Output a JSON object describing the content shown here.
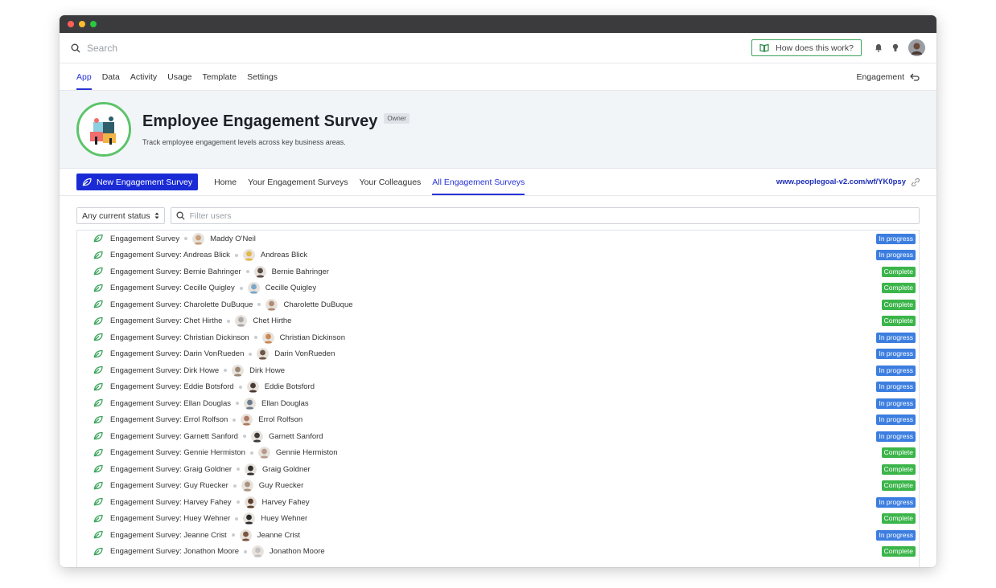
{
  "colors": {
    "accent": "#2634d6",
    "primary_button": "#1a2bd6",
    "in_progress": "#3c7ee0",
    "complete": "#3bb54a",
    "leaf": "#3aa45a"
  },
  "search": {
    "placeholder": "Search"
  },
  "help_button": {
    "label": "How does this work?"
  },
  "nav": {
    "tabs": [
      {
        "label": "App",
        "active": true
      },
      {
        "label": "Data"
      },
      {
        "label": "Activity"
      },
      {
        "label": "Usage"
      },
      {
        "label": "Template"
      },
      {
        "label": "Settings"
      }
    ],
    "right_label": "Engagement"
  },
  "hero": {
    "title": "Employee Engagement Survey",
    "badge": "Owner",
    "subtitle": "Track employee engagement levels across key business areas."
  },
  "actions": {
    "new_button": "New Engagement Survey",
    "tabs": [
      {
        "label": "Home"
      },
      {
        "label": "Your Engagement Surveys"
      },
      {
        "label": "Your Colleagues"
      },
      {
        "label": "All Engagement Surveys",
        "active": true
      }
    ],
    "url": "www.peoplegoal-v2.com/wf/YK0psy"
  },
  "filters": {
    "status_label": "Any current status",
    "filter_placeholder": "Filter users"
  },
  "status_labels": {
    "in_progress": "In progress",
    "complete": "Complete"
  },
  "rows": [
    {
      "title": "Engagement Survey",
      "user": "Maddy O'Neil",
      "status": "in_progress",
      "avatar": "#c9a07c"
    },
    {
      "title": "Engagement Survey: Andreas Blick",
      "user": "Andreas Blick",
      "status": "in_progress",
      "avatar": "#e2b84a"
    },
    {
      "title": "Engagement Survey: Bernie Bahringer",
      "user": "Bernie Bahringer",
      "status": "complete",
      "avatar": "#5a4a44"
    },
    {
      "title": "Engagement Survey: Cecille Quigley",
      "user": "Cecille Quigley",
      "status": "complete",
      "avatar": "#7aa8c9"
    },
    {
      "title": "Engagement Survey: Charolette DuBuque",
      "user": "Charolette DuBuque",
      "status": "complete",
      "avatar": "#b08c74"
    },
    {
      "title": "Engagement Survey: Chet Hirthe",
      "user": "Chet Hirthe",
      "status": "complete",
      "avatar": "#a9a9a9"
    },
    {
      "title": "Engagement Survey: Christian Dickinson",
      "user": "Christian Dickinson",
      "status": "in_progress",
      "avatar": "#c98a55"
    },
    {
      "title": "Engagement Survey: Darin VonRueden",
      "user": "Darin VonRueden",
      "status": "in_progress",
      "avatar": "#6e5548"
    },
    {
      "title": "Engagement Survey: Dirk Howe",
      "user": "Dirk Howe",
      "status": "in_progress",
      "avatar": "#9b8877"
    },
    {
      "title": "Engagement Survey: Eddie Botsford",
      "user": "Eddie Botsford",
      "status": "in_progress",
      "avatar": "#4a3a33"
    },
    {
      "title": "Engagement Survey: Ellan Douglas",
      "user": "Ellan Douglas",
      "status": "in_progress",
      "avatar": "#6b7a8c"
    },
    {
      "title": "Engagement Survey: Errol Rolfson",
      "user": "Errol Rolfson",
      "status": "in_progress",
      "avatar": "#b07a62"
    },
    {
      "title": "Engagement Survey: Garnett Sanford",
      "user": "Garnett Sanford",
      "status": "in_progress",
      "avatar": "#3a3a3a"
    },
    {
      "title": "Engagement Survey: Gennie Hermiston",
      "user": "Gennie Hermiston",
      "status": "complete",
      "avatar": "#b89a8c"
    },
    {
      "title": "Engagement Survey: Graig Goldner",
      "user": "Graig Goldner",
      "status": "complete",
      "avatar": "#2e2e2e"
    },
    {
      "title": "Engagement Survey: Guy Ruecker",
      "user": "Guy Ruecker",
      "status": "complete",
      "avatar": "#a89380"
    },
    {
      "title": "Engagement Survey: Harvey Fahey",
      "user": "Harvey Fahey",
      "status": "in_progress",
      "avatar": "#5d3d2e"
    },
    {
      "title": "Engagement Survey: Huey Wehner",
      "user": "Huey Wehner",
      "status": "complete",
      "avatar": "#2a2a2a"
    },
    {
      "title": "Engagement Survey: Jeanne Crist",
      "user": "Jeanne Crist",
      "status": "in_progress",
      "avatar": "#7a5540"
    },
    {
      "title": "Engagement Survey: Jonathon Moore",
      "user": "Jonathon Moore",
      "status": "complete",
      "avatar": "#c2c2c2"
    }
  ]
}
